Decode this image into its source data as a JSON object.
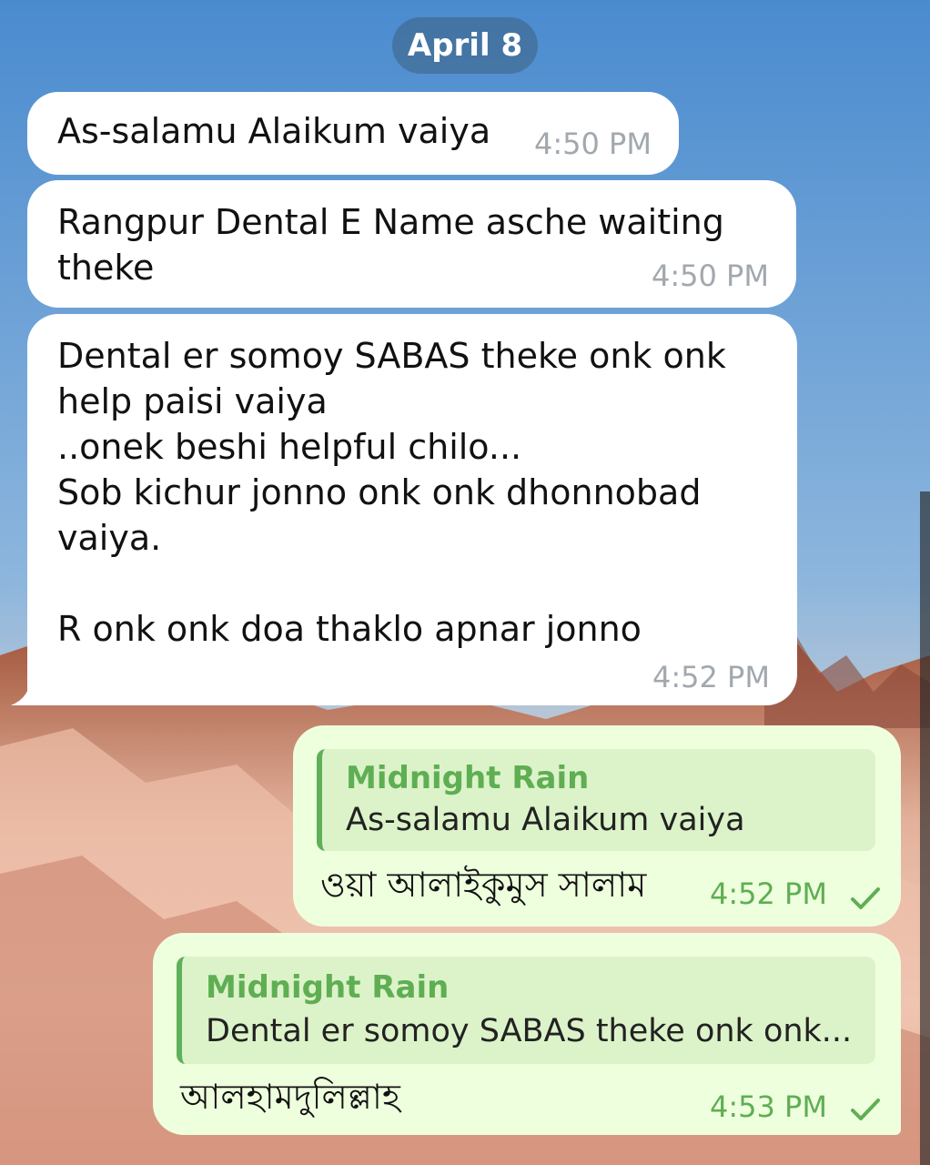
{
  "chat": {
    "date": "April 8",
    "incoming": [
      {
        "text": "As-salamu Alaikum vaiya",
        "time": "4:50 PM"
      },
      {
        "text": "Rangpur Dental E Name asche waiting\ntheke",
        "time": "4:50 PM"
      },
      {
        "text": "Dental er somoy SABAS theke onk onk\nhelp paisi vaiya\n..onek beshi helpful chilo...\nSob kichur jonno onk onk dhonnobad\nvaiya.\n\nR onk onk doa thaklo apnar jonno",
        "time": "4:52 PM"
      }
    ],
    "outgoing": [
      {
        "quote_name": "Midnight Rain",
        "quote_text": "As-salamu Alaikum vaiya",
        "text": "ওয়া আলাইকুমুস সালাম",
        "time": "4:52 PM",
        "status_icon": "single-check-icon"
      },
      {
        "quote_name": "Midnight Rain",
        "quote_text": "Dental er somoy SABAS theke onk onk...",
        "text": "আলহামদুলিল্লাহ",
        "time": "4:53 PM",
        "status_icon": "single-check-icon"
      }
    ]
  },
  "colors": {
    "incoming_bubble": "#ffffff",
    "outgoing_bubble": "#eeffde",
    "accent_green": "#5fae53",
    "date_pill": "#3c6080"
  }
}
